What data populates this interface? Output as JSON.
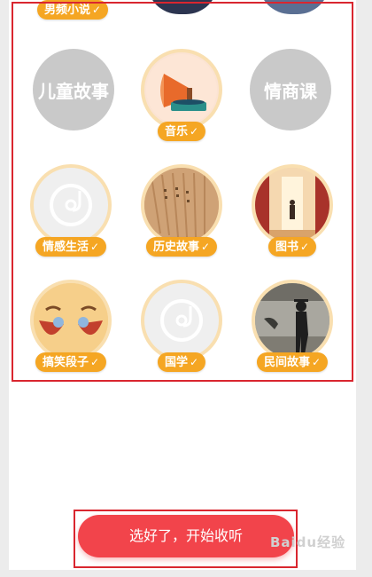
{
  "categories_top": {
    "label": "男频小说"
  },
  "categories": [
    {
      "label": "儿童故事",
      "selected": false,
      "style": "gray"
    },
    {
      "label": "音乐",
      "selected": true,
      "icon": "gramophone-icon"
    },
    {
      "label": "情商课",
      "selected": false,
      "style": "gray"
    },
    {
      "label": "情感生活",
      "selected": true,
      "icon": "music-disc-icon"
    },
    {
      "label": "历史故事",
      "selected": true,
      "icon": "bamboo-scroll-icon"
    },
    {
      "label": "图书",
      "selected": true,
      "icon": "corridor-figure-icon"
    },
    {
      "label": "搞笑段子",
      "selected": true,
      "icon": "laughing-face-icon"
    },
    {
      "label": "国学",
      "selected": true,
      "icon": "music-disc-icon"
    },
    {
      "label": "民间故事",
      "selected": true,
      "icon": "silhouette-man-icon"
    }
  ],
  "check_mark": "✓",
  "start_button": {
    "label": "选好了，开始收听"
  },
  "watermark": "Baidu经验",
  "colors": {
    "accent": "#f5a623",
    "button": "#f2444b",
    "annotation": "#d9262f"
  }
}
